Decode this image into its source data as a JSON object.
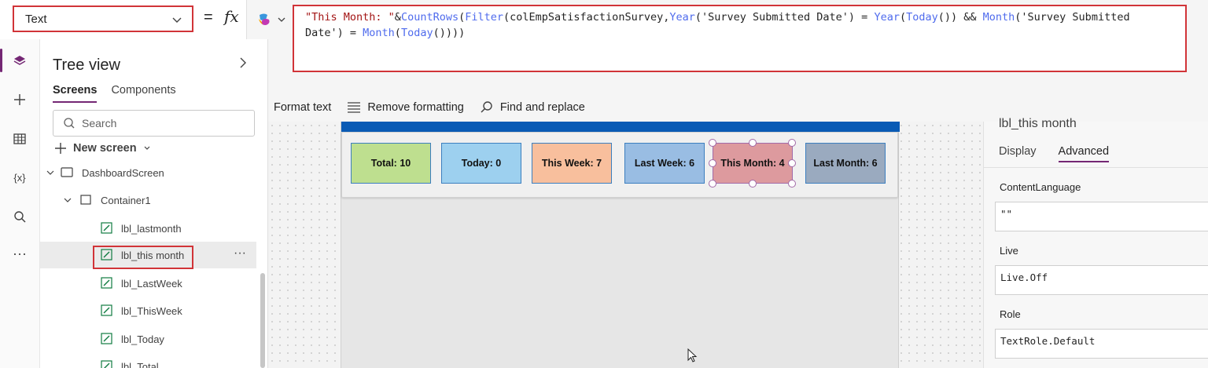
{
  "top_bar": {
    "property": "Text",
    "equals": "=",
    "fx": "fx"
  },
  "formula": {
    "line1_str": "\"This Month: \"",
    "line1_amp": "&",
    "line1_fn1": "CountRows",
    "line1_p1": "(",
    "line1_fn2": "Filter",
    "line1_p2": "(colEmpSatisfactionSurvey,",
    "line1_fn3": "Year",
    "line1_p3": "('Survey Submitted Date') = ",
    "line1_fn4": "Year",
    "line1_p4": "(",
    "line1_fn5": "Today",
    "line1_p5": "()) && ",
    "line1_fn6": "Month",
    "line1_p6": "('Survey Submitted",
    "line2_p1": "Date') = ",
    "line2_fn1": "Month",
    "line2_p2": "(",
    "line2_fn2": "Today",
    "line2_p3": "())))"
  },
  "formula_toolbar": {
    "format_text": "Format text",
    "remove_formatting": "Remove formatting",
    "find_replace": "Find and replace"
  },
  "tree": {
    "title": "Tree view",
    "tabs": [
      "Screens",
      "Components"
    ],
    "search_placeholder": "Search",
    "new_screen": "New screen",
    "nodes": [
      {
        "label": "DashboardScreen"
      },
      {
        "label": "Container1"
      },
      {
        "label": "lbl_lastmonth"
      },
      {
        "label": "lbl_this month"
      },
      {
        "label": "lbl_LastWeek"
      },
      {
        "label": "lbl_ThisWeek"
      },
      {
        "label": "lbl_Today"
      },
      {
        "label": "lbl_Total"
      }
    ]
  },
  "cards": [
    {
      "label": "Total: 10",
      "color": "#bedf8f"
    },
    {
      "label": "Today: 0",
      "color": "#9dd0ef"
    },
    {
      "label": "This Week: 7",
      "color": "#f8bf9d"
    },
    {
      "label": "Last Week: 6",
      "color": "#99bde3"
    },
    {
      "label": "This Month: 4",
      "color": "#dd9a9e"
    },
    {
      "label": "Last Month: 6",
      "color": "#9aaabf"
    }
  ],
  "properties": {
    "title": "lbl_this month",
    "tabs": [
      "Display",
      "Advanced"
    ],
    "content_language_label": "ContentLanguage",
    "content_language_value": "\"\"",
    "live_label": "Live",
    "live_value": "Live.Off",
    "role_label": "Role",
    "role_value": "TextRole.Default"
  },
  "colors": {
    "accent": "#742774",
    "highlight": "#d13438",
    "header_blue": "#0a5bb5"
  }
}
